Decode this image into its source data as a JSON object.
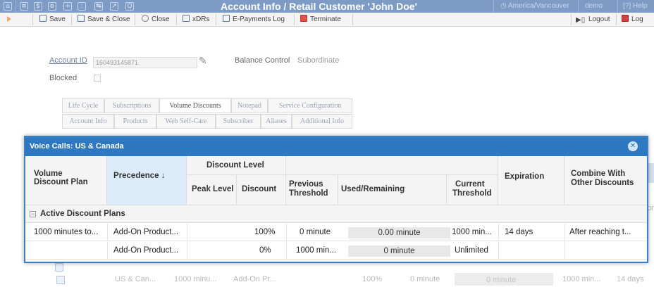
{
  "titlebar": {
    "title": "Account Info / Retail Customer 'John Doe'",
    "timezone": "America/Vancouver",
    "user": "demo",
    "help": "Help",
    "icons": [
      "home-icon",
      "list-icon",
      "dollar-icon",
      "users-icon",
      "plus-icon",
      "grid-icon",
      "flow-icon",
      "chart-icon",
      "search-icon"
    ]
  },
  "toolbar": {
    "save": "Save",
    "save_close": "Save & Close",
    "close": "Close",
    "xdrs": "xDRs",
    "epayments": "E-Payments Log",
    "terminate": "Terminate",
    "logout": "Logout",
    "log": "Log"
  },
  "form": {
    "account_id_label": "Account ID",
    "account_id_value": "160493145871",
    "balance_control_label": "Balance Control",
    "balance_control_value": "Subordinate",
    "blocked_label": "Blocked"
  },
  "tabs": {
    "row1": [
      "Life Cycle",
      "Subscriptions",
      "Volume Discounts",
      "Notepad",
      "Service Configuration"
    ],
    "row2": [
      "Account Info",
      "Products",
      "Web Self-Care",
      "Subscriber",
      "Aliases",
      "Additional Info"
    ]
  },
  "background_row": {
    "plan": "US & Can...",
    "minutes": "1000 minu...",
    "product": "Add-On Pr...",
    "discount": "100%",
    "prev": "0 minute",
    "used": "0 minute",
    "current": "1000 min...",
    "expiration": "14 days",
    "edge_text": "or"
  },
  "modal": {
    "title": "Voice Calls: US & Canada",
    "headers": {
      "plan": "Volume\nDiscount Plan",
      "plan_l1": "Volume",
      "plan_l2": "Discount Plan",
      "precedence": "Precedence ↓",
      "discount_level": "Discount Level",
      "peak_level": "Peak Level",
      "discount": "Discount",
      "prev_l1": "Previous",
      "prev_l2": "Threshold",
      "used": "Used/Remaining",
      "cur_l1": "Current",
      "cur_l2": "Threshold",
      "expiration": "Expiration",
      "combine_l1": "Combine With",
      "combine_l2": "Other Discounts"
    },
    "group_label": "Active Discount Plans",
    "rows": [
      {
        "plan": "1000 minutes to...",
        "precedence": "Add-On Product...",
        "peak": "",
        "discount": "100%",
        "previous": "0 minute",
        "used": "0.00 minute",
        "current": "1000 min...",
        "expiration": "14 days",
        "combine": "After reaching t..."
      },
      {
        "plan": "",
        "precedence": "Add-On Product...",
        "peak": "",
        "discount": "0%",
        "previous": "1000 min...",
        "used": "0 minute",
        "current": "Unlimited",
        "expiration": "",
        "combine": ""
      }
    ]
  }
}
